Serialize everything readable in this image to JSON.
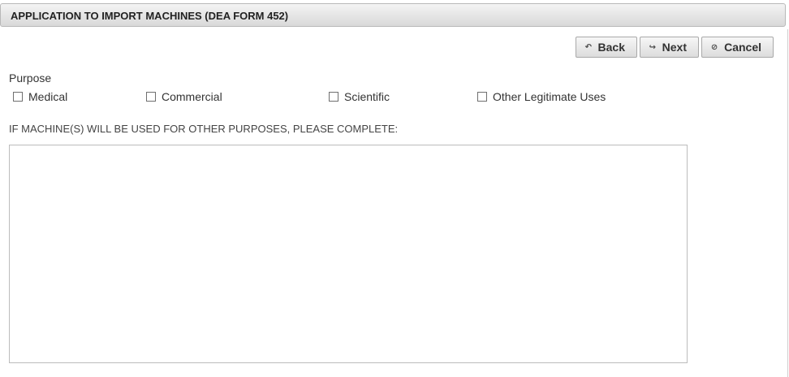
{
  "header": {
    "title": "APPLICATION TO IMPORT MACHINES (DEA FORM 452)"
  },
  "toolbar": {
    "back_label": "Back",
    "next_label": "Next",
    "cancel_label": "Cancel",
    "back_icon": "back-arrow-icon",
    "next_icon": "forward-arrow-icon",
    "cancel_icon": "cancel-circle-icon"
  },
  "purpose": {
    "label": "Purpose",
    "options": [
      {
        "label": "Medical",
        "checked": false
      },
      {
        "label": "Commercial",
        "checked": false
      },
      {
        "label": "Scientific",
        "checked": false
      },
      {
        "label": "Other Legitimate Uses",
        "checked": false
      }
    ]
  },
  "other_purposes": {
    "label": "IF MACHINE(S) WILL BE USED FOR OTHER PURPOSES, PLEASE COMPLETE:",
    "value": ""
  }
}
